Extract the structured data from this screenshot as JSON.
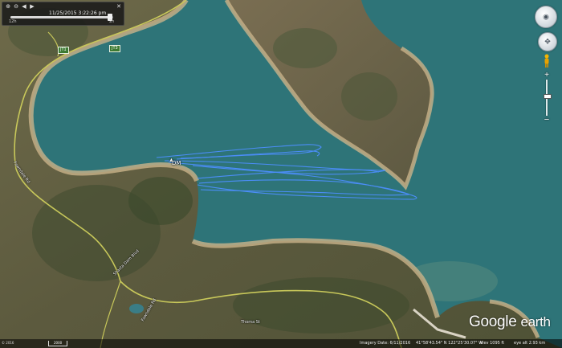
{
  "time_slider": {
    "date_label": "11/25/2015",
    "time_label": "3:22:26 pm",
    "start_label": "12h",
    "end_label": "2h",
    "position_fraction": 0.97
  },
  "map": {
    "track_label": "DM",
    "road_shields": [
      "JT1",
      "JT3"
    ],
    "road_labels": {
      "road_west": "Fawndale Rd",
      "road_south": "Shasta Dam Blvd",
      "road_mid": "Thoma St",
      "road_east": "Fawndale Rd"
    },
    "colors": {
      "water": "#2d7377",
      "track": "#4d8fff",
      "road": "#c8c85a"
    }
  },
  "navigation": {
    "look_icon": "compass-ring-icon",
    "move_icon": "pan-arrows-icon",
    "pegman_icon": "street-view-pegman-icon",
    "zoom_plus": "+",
    "zoom_minus": "−",
    "zoom_level_fraction": 0.45
  },
  "watermark": {
    "brand": "Google",
    "product": "earth"
  },
  "status_bar": {
    "imagery_date": "Imagery Date: 6/11/2016",
    "coordinates": "41°58'43.54\" N 122°25'30.07\" W",
    "elevation": "elev 1095 ft",
    "eye_alt": "eye alt 2.93 km",
    "scale": "2000",
    "copyright": "© 2016"
  }
}
